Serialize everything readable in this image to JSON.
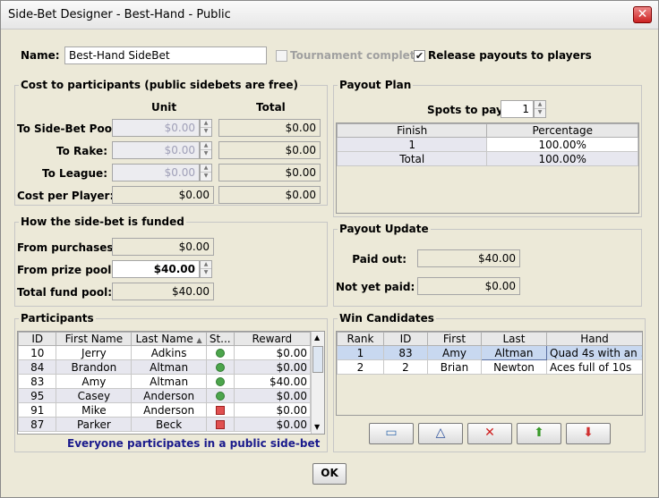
{
  "window": {
    "title": "Side-Bet Designer - Best-Hand - Public"
  },
  "top": {
    "name_label": "Name:",
    "name_value": "Best-Hand SideBet",
    "tournament_complete_label": "Tournament complete",
    "release_payouts_label": "Release payouts to players",
    "tournament_complete_checked": false,
    "release_payouts_checked": true
  },
  "cost": {
    "title": "Cost to participants (public sidebets are free)",
    "unit_header": "Unit",
    "total_header": "Total",
    "rows": [
      {
        "label": "To Side-Bet Pool:",
        "unit": "$0.00",
        "total": "$0.00"
      },
      {
        "label": "To Rake:",
        "unit": "$0.00",
        "total": "$0.00"
      },
      {
        "label": "To League:",
        "unit": "$0.00",
        "total": "$0.00"
      },
      {
        "label": "Cost per Player:",
        "unit": "$0.00",
        "total": "$0.00"
      }
    ]
  },
  "funded": {
    "title": "How the side-bet is funded",
    "rows": [
      {
        "label": "From purchases:",
        "value": "$0.00"
      },
      {
        "label": "From prize pool:",
        "value": "$40.00"
      },
      {
        "label": "Total fund pool:",
        "value": "$40.00"
      }
    ]
  },
  "participants": {
    "title": "Participants",
    "columns": [
      "ID",
      "First Name",
      "Last Name",
      "St...",
      "Reward"
    ],
    "rows": [
      {
        "id": "10",
        "first": "Jerry",
        "last": "Adkins",
        "status": "green",
        "reward": "$0.00"
      },
      {
        "id": "84",
        "first": "Brandon",
        "last": "Altman",
        "status": "green",
        "reward": "$0.00"
      },
      {
        "id": "83",
        "first": "Amy",
        "last": "Altman",
        "status": "green",
        "reward": "$40.00"
      },
      {
        "id": "95",
        "first": "Casey",
        "last": "Anderson",
        "status": "green",
        "reward": "$0.00"
      },
      {
        "id": "91",
        "first": "Mike",
        "last": "Anderson",
        "status": "red",
        "reward": "$0.00"
      },
      {
        "id": "87",
        "first": "Parker",
        "last": "Beck",
        "status": "red",
        "reward": "$0.00"
      }
    ],
    "footer": "Everyone participates in a public side-bet"
  },
  "payout_plan": {
    "title": "Payout Plan",
    "spots_label": "Spots to pay:",
    "spots_value": "1",
    "columns": [
      "Finish",
      "Percentage"
    ],
    "rows": [
      {
        "finish": "1",
        "percentage": "100.00%"
      },
      {
        "finish": "Total",
        "percentage": "100.00%"
      }
    ]
  },
  "payout_update": {
    "title": "Payout Update",
    "paid_out_label": "Paid out:",
    "paid_out_value": "$40.00",
    "not_paid_label": "Not yet paid:",
    "not_paid_value": "$0.00"
  },
  "win_candidates": {
    "title": "Win Candidates",
    "columns": [
      "Rank",
      "ID",
      "First",
      "Last",
      "Hand"
    ],
    "rows": [
      {
        "rank": "1",
        "id": "83",
        "first": "Amy",
        "last": "Altman",
        "hand": "Quad 4s with an ..."
      },
      {
        "rank": "2",
        "id": "2",
        "first": "Brian",
        "last": "Newton",
        "hand": "Aces full of 10s"
      }
    ]
  },
  "buttons": {
    "ok": "OK",
    "toolbar_icons": [
      "new-icon",
      "triangle-icon",
      "delete-icon",
      "up-arrow-icon",
      "down-arrow-icon"
    ]
  },
  "colors": {
    "status_green": "#4ca54c",
    "status_red": "#e05050",
    "footer_text": "#1a1a8c"
  }
}
